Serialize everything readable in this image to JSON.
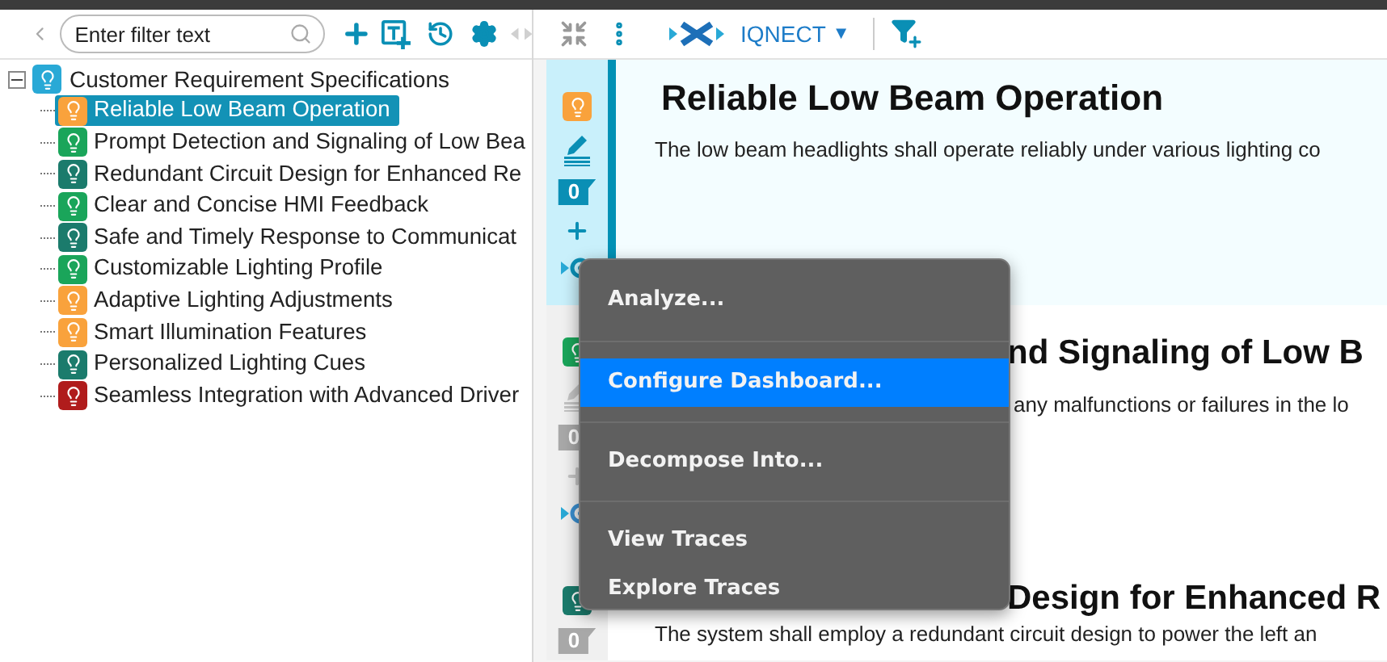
{
  "toolbar": {
    "filter": {
      "placeholder": "Enter filter text"
    },
    "product": "IQNECT",
    "product_caret": "▼"
  },
  "tree": {
    "label": "Customer Requirement Specifications",
    "expanded": true,
    "color": "#29a9d6",
    "children": [
      {
        "label": "Reliable Low Beam Operation",
        "color": "#f9a23c",
        "selected": true
      },
      {
        "label": "Prompt Detection and Signaling of Low Bea",
        "color": "#1aa55a",
        "selected": false
      },
      {
        "label": "Redundant Circuit Design for Enhanced Re",
        "color": "#1b7b6c",
        "selected": false
      },
      {
        "label": "Clear and Concise HMI Feedback",
        "color": "#1aa55a",
        "selected": false
      },
      {
        "label": "Safe and Timely Response to Communicat",
        "color": "#1b7b6c",
        "selected": false
      },
      {
        "label": "Customizable Lighting Profile",
        "color": "#1aa55a",
        "selected": false
      },
      {
        "label": "Adaptive Lighting Adjustments",
        "color": "#f9a23c",
        "selected": false
      },
      {
        "label": "Smart Illumination Features",
        "color": "#f9a23c",
        "selected": false
      },
      {
        "label": "Personalized Lighting Cues",
        "color": "#1b7b6c",
        "selected": false
      },
      {
        "label": "Seamless Integration with Advanced Driver",
        "color": "#b01c1c",
        "selected": false
      }
    ]
  },
  "sections": [
    {
      "title": "Reliable Low Beam Operation",
      "description": "The low beam headlights shall operate reliably under various lighting co",
      "color": "#f9a23c",
      "count": "0",
      "selected": true
    },
    {
      "title": "nd Signaling of Low B",
      "description": "any malfunctions or failures in the lo",
      "color": "#1aa55a",
      "count": "0",
      "selected": false
    },
    {
      "title": "Design for Enhanced R",
      "description": "The system shall employ a redundant circuit design to power the left an",
      "color": "#1b7b6c",
      "count": "0",
      "selected": false
    }
  ],
  "context_menu": {
    "items": [
      {
        "label": "Analyze...",
        "selected": false
      },
      {
        "label": "Configure Dashboard...",
        "selected": true
      },
      {
        "label": "Decompose Into...",
        "selected": false
      },
      {
        "label": "View Traces",
        "selected": false
      },
      {
        "label": "Explore Traces",
        "selected": false
      }
    ]
  }
}
